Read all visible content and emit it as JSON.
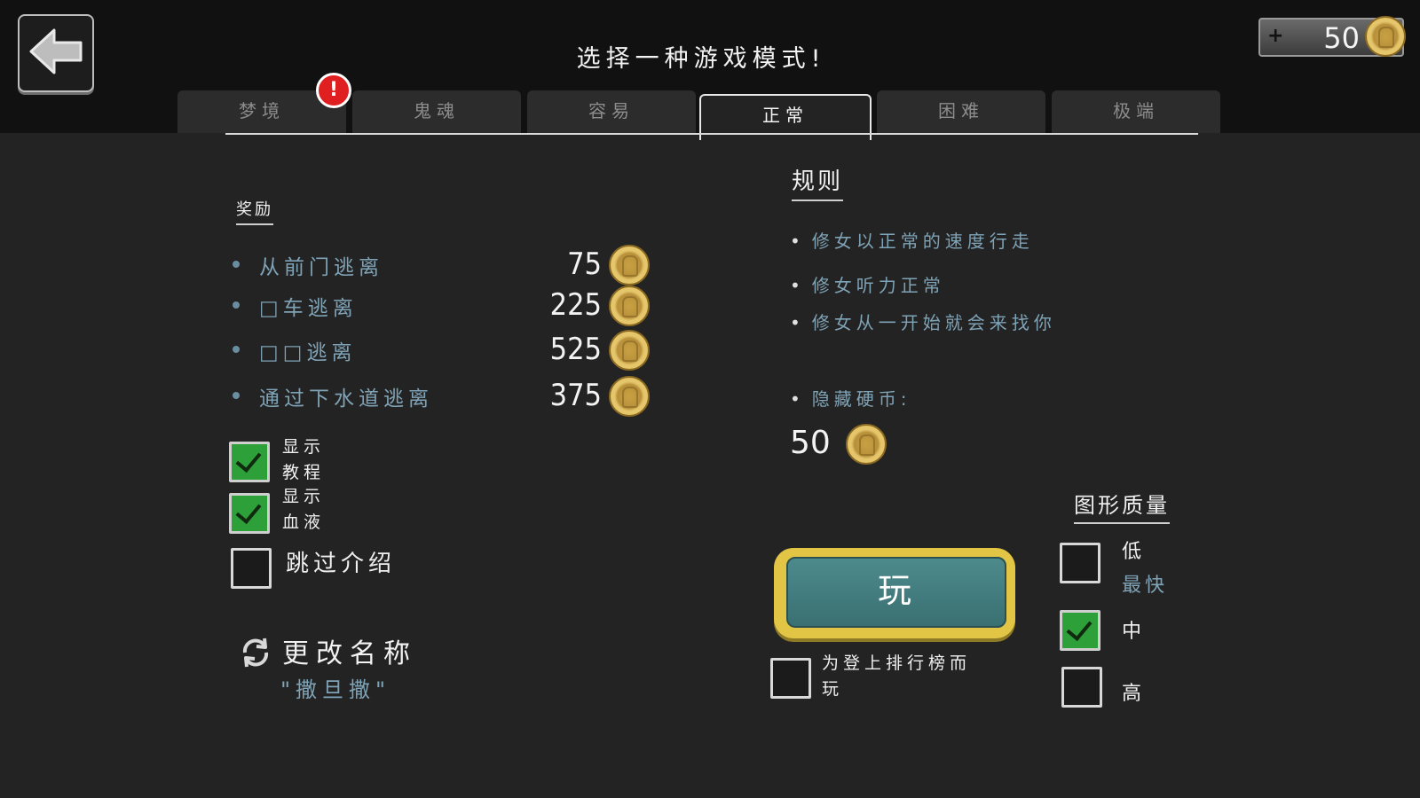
{
  "header": {
    "title": "选择一种游戏模式!",
    "coins": "50",
    "coins_plus": "+"
  },
  "tabs": [
    {
      "label": "梦境",
      "active": false
    },
    {
      "label": "鬼魂",
      "active": false
    },
    {
      "label": "容易",
      "active": false
    },
    {
      "label": "正常",
      "active": true
    },
    {
      "label": "困难",
      "active": false
    },
    {
      "label": "极端",
      "active": false
    }
  ],
  "alert": "!",
  "rewards": {
    "heading": "奖励",
    "items": [
      {
        "label": "从前门逃离",
        "value": "75"
      },
      {
        "label": "□车逃离",
        "value": "225"
      },
      {
        "label": "□□逃离",
        "value": "525"
      },
      {
        "label": "通过下水道逃离",
        "value": "375"
      }
    ]
  },
  "options": {
    "show_tutorial": {
      "label_line1": "显示",
      "label_line2": "教程",
      "checked": true
    },
    "show_blood": {
      "label_line1": "显示",
      "label_line2": "血液",
      "checked": true
    },
    "skip_intro": {
      "label": "跳过介绍",
      "checked": false
    }
  },
  "rename": {
    "title": "更改名称",
    "current_name": "\"撒旦撒\""
  },
  "rules": {
    "heading": "规则",
    "items": [
      "修女以正常的速度行走",
      "修女听力正常",
      "修女从一开始就会来找你"
    ],
    "hidden_coins_label": "隐藏硬币:",
    "hidden_coins_value": "50"
  },
  "play": {
    "label": "玩",
    "leaderboard_label_line1": "为登上排行榜而",
    "leaderboard_label_line2": "玩",
    "leaderboard_checked": false
  },
  "graphics": {
    "heading": "图形质量",
    "low": {
      "label": "低",
      "sub": "最快",
      "checked": false
    },
    "medium": {
      "label": "中",
      "checked": true
    },
    "high": {
      "label": "高",
      "checked": false
    }
  },
  "colors": {
    "accent_text": "#7fa3b6",
    "play_border": "#e2c545",
    "play_fill": "#4d8a8c",
    "check_green": "#2ea03a",
    "alert_red": "#e02020"
  }
}
